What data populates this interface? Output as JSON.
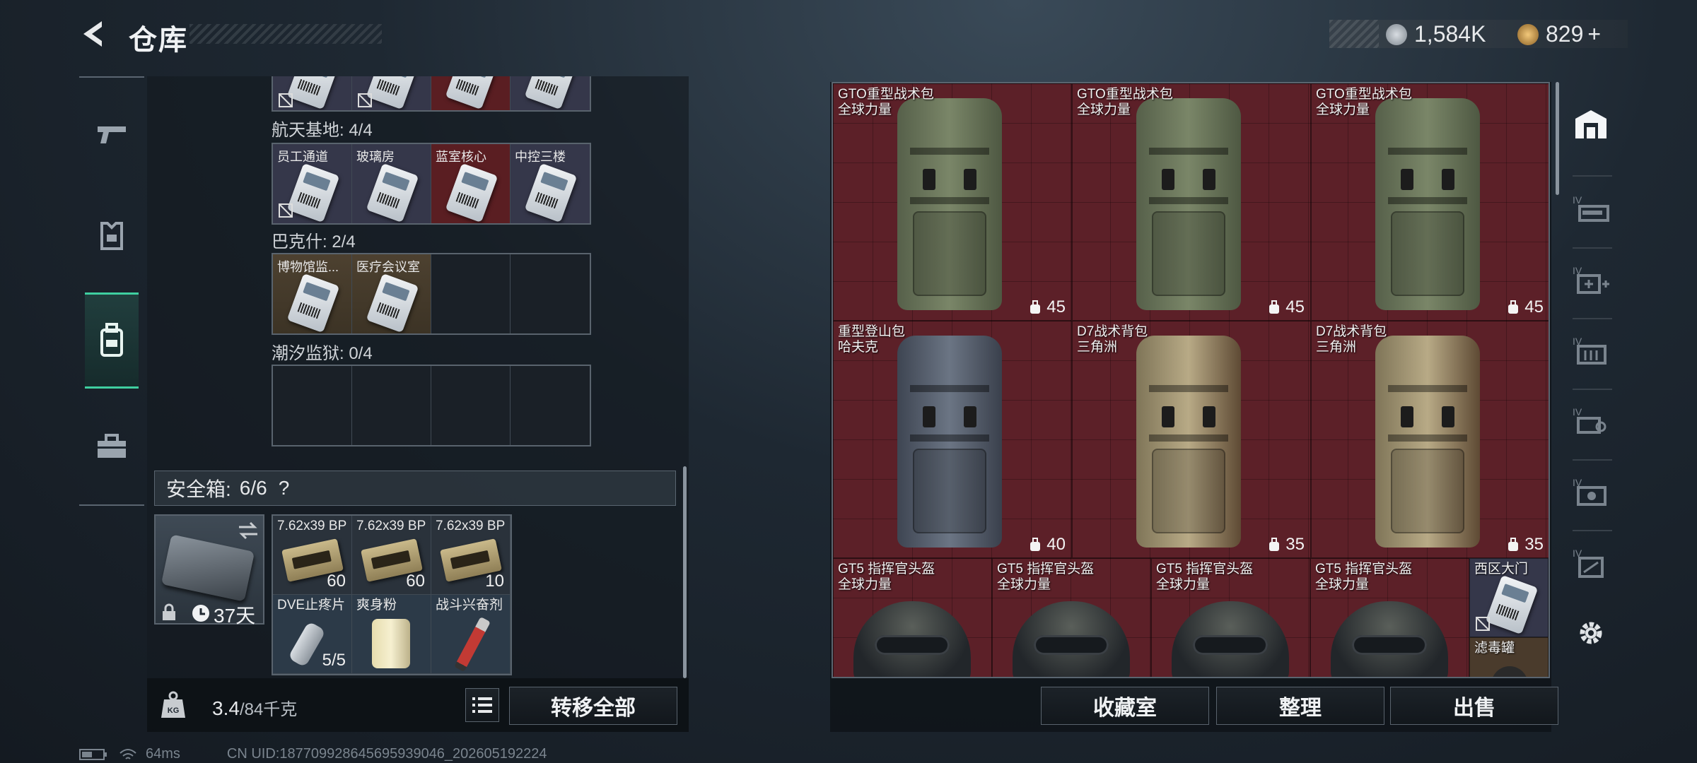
{
  "header": {
    "title": "仓库"
  },
  "currency": {
    "silver": "1,584K",
    "gold": "829",
    "gold_plus": "+",
    "silver_color": "#9aa3ad",
    "gold_color": "#d4a04c"
  },
  "side_nav": {
    "items": [
      "gun-icon",
      "armor-icon",
      "backpack-icon",
      "toolbox-icon"
    ],
    "active": "backpack-icon"
  },
  "key_sections": [
    {
      "label": "航天基地: 4/4",
      "cells": [
        {
          "name": "员工通道",
          "type": "card",
          "locked": true,
          "bg": "lav"
        },
        {
          "name": "玻璃房",
          "type": "card",
          "bg": "lav"
        },
        {
          "name": "蓝室核心",
          "type": "card",
          "bg": "red"
        },
        {
          "name": "中控三楼",
          "type": "card",
          "bg": "lav"
        }
      ]
    },
    {
      "label": "巴克什: 2/4",
      "cells": [
        {
          "name": "博物馆监...",
          "type": "card",
          "bg": "gold"
        },
        {
          "name": "医疗会议室",
          "type": "card",
          "bg": "gold"
        },
        {
          "name": "",
          "type": "empty"
        },
        {
          "name": "",
          "type": "empty"
        }
      ]
    },
    {
      "label": "潮汐监狱: 0/4",
      "cells": [
        {
          "name": "",
          "type": "empty"
        },
        {
          "name": "",
          "type": "empty"
        },
        {
          "name": "",
          "type": "empty"
        },
        {
          "name": "",
          "type": "empty"
        }
      ]
    }
  ],
  "safe_box": {
    "label": "安全箱:",
    "count": "6/6",
    "help": "?",
    "days": "37天"
  },
  "safe_items": [
    {
      "name": "7.62x39 BP",
      "count": "60",
      "kind": "ammo"
    },
    {
      "name": "7.62x39 BP",
      "count": "60",
      "kind": "ammo"
    },
    {
      "name": "7.62x39 BP",
      "count": "10",
      "kind": "ammo"
    },
    {
      "name": "DVE止疼片",
      "count": "5/5",
      "kind": "pill"
    },
    {
      "name": "爽身粉",
      "count": "",
      "kind": "jar"
    },
    {
      "name": "战斗兴奋剂",
      "count": "",
      "kind": "syringe"
    }
  ],
  "weight": {
    "current": "3.4",
    "max": "/84千克"
  },
  "buttons": {
    "transfer_all": "转移全部",
    "collection": "收藏室",
    "sort": "整理",
    "sell": "出售"
  },
  "stash_items": [
    {
      "name": "GTO重型战术包",
      "sub": "全球力量",
      "cap": "45",
      "color": "#6f7a62"
    },
    {
      "name": "GTO重型战术包",
      "sub": "全球力量",
      "cap": "45",
      "color": "#6f7a62"
    },
    {
      "name": "GTO重型战术包",
      "sub": "全球力量",
      "cap": "45",
      "color": "#6f7a62"
    },
    {
      "name": "重型登山包",
      "sub": "哈夫克",
      "cap": "40",
      "color": "#5a6472"
    },
    {
      "name": "D7战术背包",
      "sub": "三角洲",
      "cap": "35",
      "color": "#a89a78"
    },
    {
      "name": "D7战术背包",
      "sub": "三角洲",
      "cap": "35",
      "color": "#a89a78"
    }
  ],
  "helmets": [
    {
      "name": "GT5 指挥官头盔",
      "sub": "全球力量"
    },
    {
      "name": "GT5 指挥官头盔",
      "sub": "全球力量"
    },
    {
      "name": "GT5 指挥官头盔",
      "sub": "全球力量"
    },
    {
      "name": "GT5 指挥官头盔",
      "sub": "全球力量"
    }
  ],
  "small_items": [
    {
      "name": "西区大门",
      "type": "card"
    },
    {
      "name": "滤毒罐",
      "type": "canister"
    }
  ],
  "right_rail": [
    "home-icon",
    "rifle-case-icon",
    "medkit-case-icon",
    "ammo-case-icon",
    "key-case-icon",
    "gear-case-icon",
    "misc-case-icon",
    "settings-icon"
  ],
  "footer": {
    "ping": "64ms",
    "uid": "CN UID:18770992864569593904​6_202605192224"
  }
}
